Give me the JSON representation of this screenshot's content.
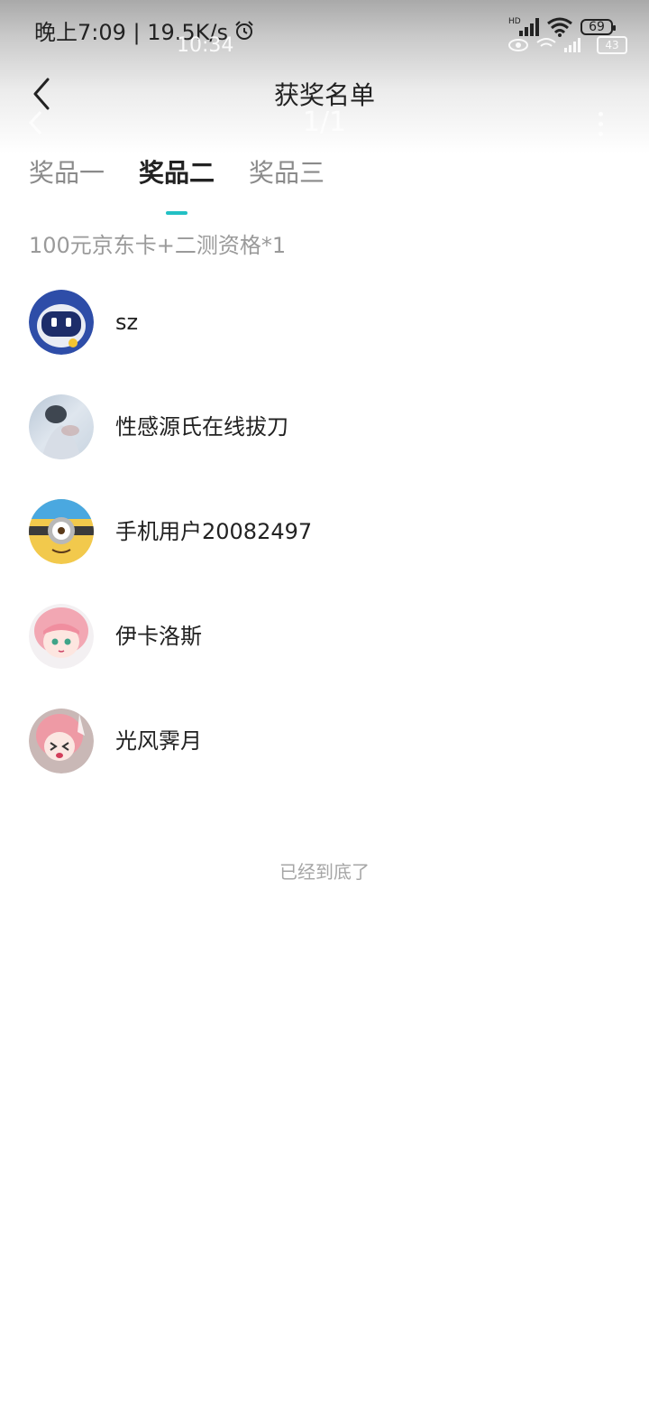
{
  "status_bar": {
    "time_speed": "晚上7:09 | 19.5K/s",
    "battery": "69",
    "network_hd": "HD",
    "ghost_time": "10:34",
    "ghost_battery": "43"
  },
  "header": {
    "title": "获奖名单",
    "ghost_page_indicator": "1/1"
  },
  "tabs": [
    {
      "label": "奖品一",
      "active": false
    },
    {
      "label": "奖品二",
      "active": true
    },
    {
      "label": "奖品三",
      "active": false
    }
  ],
  "prize_description": "100元京东卡+二测资格*1",
  "winners": [
    {
      "name": "sz",
      "avatar_icon": "robot-avatar"
    },
    {
      "name": "性感源氏在线拔刀",
      "avatar_icon": "photo-avatar"
    },
    {
      "name": "手机用户20082497",
      "avatar_icon": "minion-avatar"
    },
    {
      "name": "伊卡洛斯",
      "avatar_icon": "anime-girl-avatar"
    },
    {
      "name": "光风霁月",
      "avatar_icon": "anime-girl-crying-avatar"
    }
  ],
  "footer_text": "已经到底了",
  "colors": {
    "accent": "#22c0c4",
    "inactive_tab": "#8a8a8a",
    "secondary_text": "#9a9a9a"
  }
}
